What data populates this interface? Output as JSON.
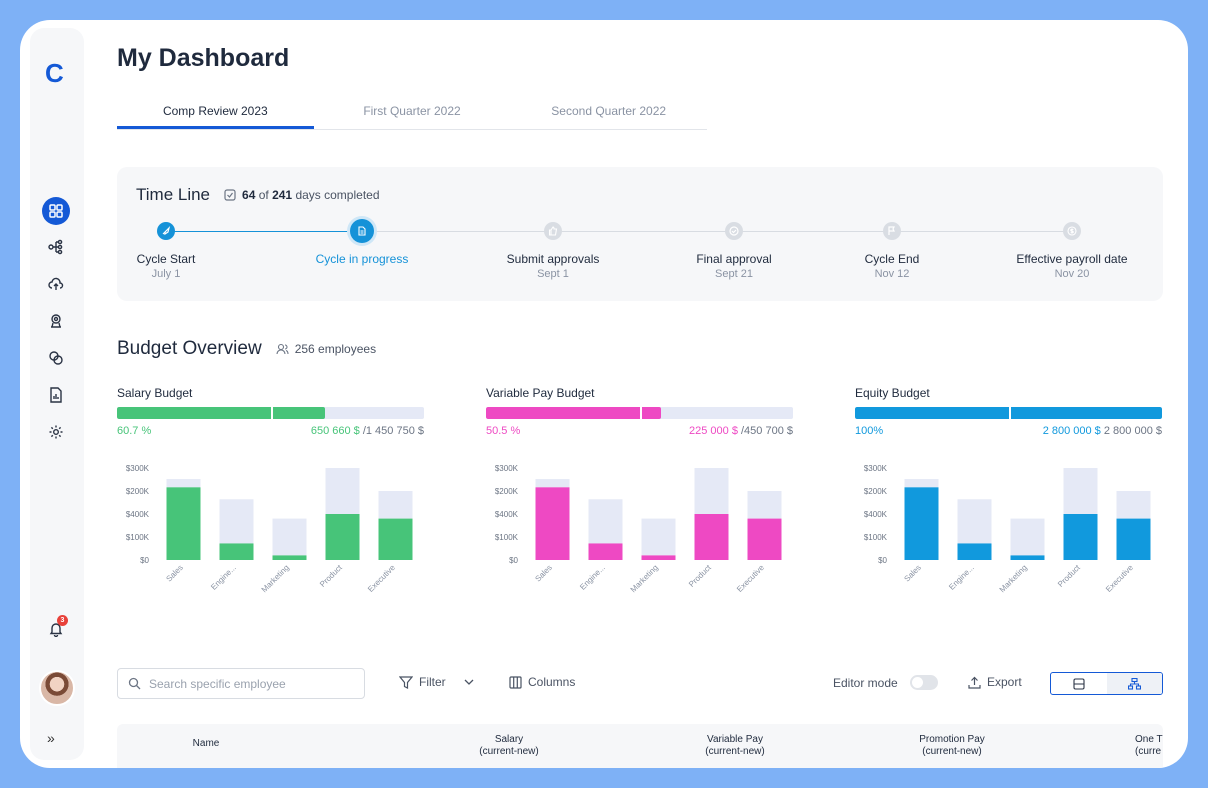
{
  "app": {
    "logo": "C",
    "page_title": "My Dashboard"
  },
  "sidebar": {
    "icons": [
      "dashboard-icon",
      "org-chart-icon",
      "upload-cloud-icon",
      "award-icon",
      "people-cycle-icon",
      "report-icon",
      "gear-icon"
    ],
    "notification_count": "3",
    "expand_label": "»"
  },
  "tabs": [
    {
      "label": "Comp Review 2023",
      "active": true
    },
    {
      "label": "First Quarter 2022",
      "active": false
    },
    {
      "label": "Second Quarter 2022",
      "active": false
    }
  ],
  "timeline": {
    "title": "Time Line",
    "days_done": "64",
    "days_of": "of",
    "days_total": "241",
    "days_suffix": "days completed",
    "steps": [
      {
        "label": "Cycle Start",
        "date": "July 1",
        "state": "done",
        "icon": "rocket-icon"
      },
      {
        "label": "Cycle in progress",
        "date": "",
        "state": "current",
        "icon": "document-icon"
      },
      {
        "label": "Submit approvals",
        "date": "Sept 1",
        "state": "pending",
        "icon": "thumbs-up-icon"
      },
      {
        "label": "Final approval",
        "date": "Sept 21",
        "state": "pending",
        "icon": "check-circle-icon"
      },
      {
        "label": "Cycle End",
        "date": "Nov 12",
        "state": "pending",
        "icon": "flag-icon"
      },
      {
        "label": "Effective payroll date",
        "date": "Nov 20",
        "state": "pending",
        "icon": "dollar-icon"
      }
    ]
  },
  "budget_overview": {
    "title": "Budget Overview",
    "employees": "256 employees"
  },
  "budgets": [
    {
      "label": "Salary Budget",
      "percent": "60.7 %",
      "used": "650 660 $",
      "total": "/1 450 750 $",
      "fill": 0.677,
      "split": 0.5,
      "color": "#47c479"
    },
    {
      "label": "Variable Pay Budget",
      "percent": "50.5 %",
      "used": "225 000 $",
      "total": "/450 700 $",
      "fill": 0.57,
      "split": 0.5,
      "color": "#ee49c3"
    },
    {
      "label": "Equity Budget",
      "percent": "100%",
      "used": "2 800 000 $",
      "total": "2 800 000 $",
      "fill": 1.0,
      "split": 0.5,
      "color": "#1199dd"
    }
  ],
  "chart_data": [
    {
      "type": "bar",
      "title": "Salary Budget",
      "categories": [
        "Sales",
        "Engine...",
        "Marketing",
        "Product",
        "Executive"
      ],
      "y_tick_labels": [
        "$0",
        "$100K",
        "$400K",
        "$200K",
        "$300K"
      ],
      "series": [
        {
          "values": [
            0.79,
            0.18,
            0.05,
            0.5,
            0.45
          ]
        },
        {
          "values": [
            0.09,
            0.48,
            0.4,
            0.5,
            0.3
          ]
        }
      ],
      "colors": [
        "#47c479",
        "#e5e9f6"
      ]
    },
    {
      "type": "bar",
      "title": "Variable Pay Budget",
      "categories": [
        "Sales",
        "Engine...",
        "Marketing",
        "Product",
        "Executive"
      ],
      "y_tick_labels": [
        "$0",
        "$100K",
        "$400K",
        "$200K",
        "$300K"
      ],
      "series": [
        {
          "values": [
            0.79,
            0.18,
            0.05,
            0.5,
            0.45
          ]
        },
        {
          "values": [
            0.09,
            0.48,
            0.4,
            0.5,
            0.3
          ]
        }
      ],
      "colors": [
        "#ee49c3",
        "#e5e9f6"
      ]
    },
    {
      "type": "bar",
      "title": "Equity Budget",
      "categories": [
        "Sales",
        "Engine...",
        "Marketing",
        "Product",
        "Executive"
      ],
      "y_tick_labels": [
        "$0",
        "$100K",
        "$400K",
        "$200K",
        "$300K"
      ],
      "series": [
        {
          "values": [
            0.79,
            0.18,
            0.05,
            0.5,
            0.45
          ]
        },
        {
          "values": [
            0.09,
            0.48,
            0.4,
            0.5,
            0.3
          ]
        }
      ],
      "colors": [
        "#1199dd",
        "#e5e9f6"
      ]
    }
  ],
  "toolbar": {
    "search_placeholder": "Search specific employee",
    "filter_label": "Filter",
    "columns_label": "Columns",
    "editor_mode_label": "Editor mode",
    "export_label": "Export"
  },
  "table": {
    "columns": [
      {
        "line1": "Name",
        "line2": ""
      },
      {
        "line1": "Salary",
        "line2": "(current-new)"
      },
      {
        "line1": "Variable Pay",
        "line2": "(current-new)"
      },
      {
        "line1": "Promotion Pay",
        "line2": "(current-new)"
      },
      {
        "line1": "One T",
        "line2": "(curre"
      }
    ]
  }
}
